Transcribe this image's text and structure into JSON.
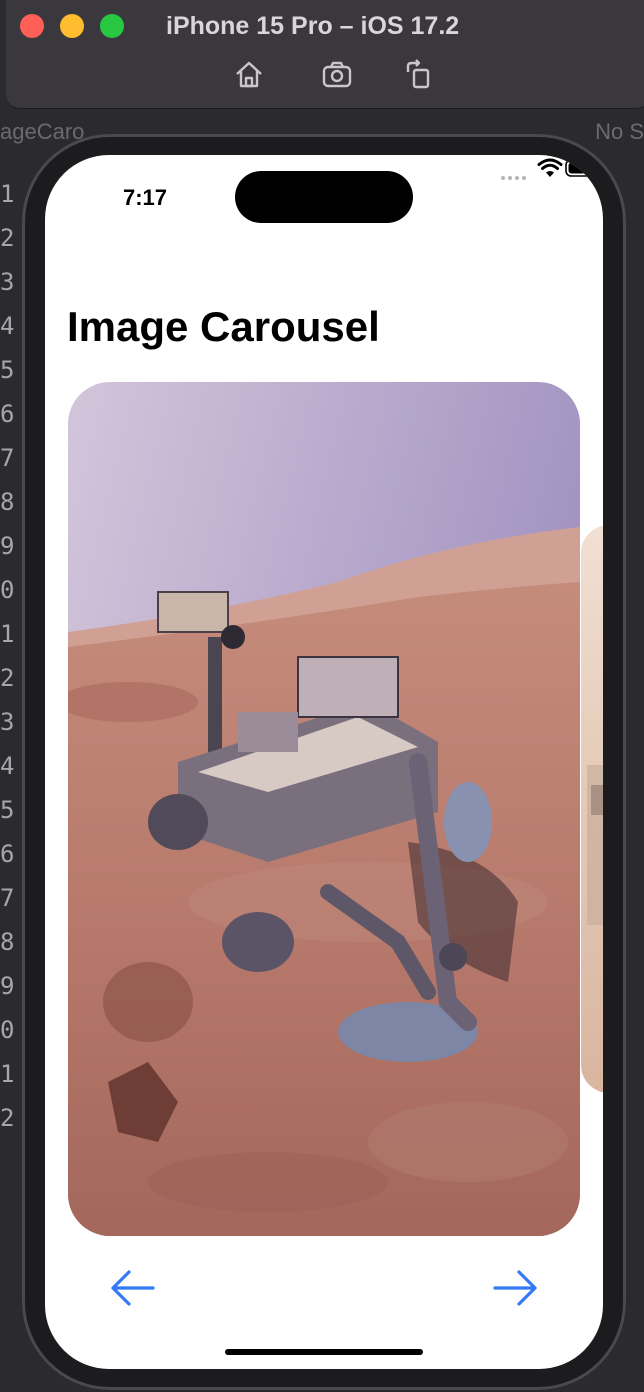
{
  "simulator": {
    "title": "iPhone 15 Pro – iOS 17.2",
    "toolbar": [
      {
        "name": "home-icon"
      },
      {
        "name": "screenshot-icon"
      },
      {
        "name": "rotate-icon"
      }
    ]
  },
  "editor": {
    "tab_fragment_left": "ageCaro",
    "tab_fragment_right": "No S",
    "line_numbers": [
      "1",
      "2",
      "3",
      "4",
      "5",
      "6",
      "7",
      "8",
      "9",
      "0",
      "1",
      "2",
      "3",
      "4",
      "5",
      "6",
      "7",
      "8",
      "9",
      "0",
      "1",
      "2"
    ]
  },
  "status_bar": {
    "time": "7:17"
  },
  "app": {
    "title": "Image Carousel",
    "current_image": "mars-rover-selfie",
    "navigation": {
      "previous_icon": "arrow-left-icon",
      "next_icon": "arrow-right-icon"
    }
  },
  "colors": {
    "accent": "#3478f6",
    "traffic_close": "#fe5f57",
    "traffic_minimize": "#febc2e",
    "traffic_maximize": "#28c840"
  }
}
